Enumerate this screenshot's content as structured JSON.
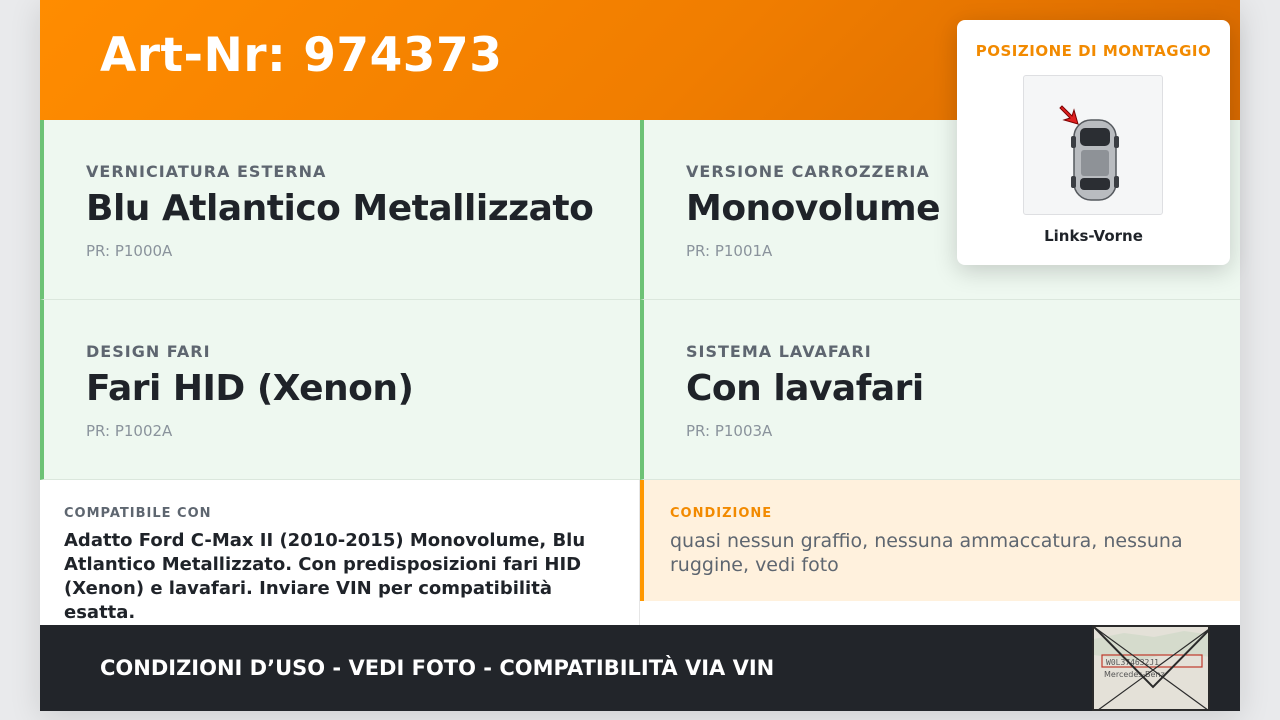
{
  "header": {
    "art_nr": "Art-Nr: 974373"
  },
  "options": [
    {
      "label": "VERNICIATURA ESTERNA",
      "value": "Blu Atlantico Metallizzato",
      "pr": "PR: P1000A"
    },
    {
      "label": "VERSIONE CARROZZERIA",
      "value": "Monovolume",
      "pr": "PR: P1001A"
    },
    {
      "label": "DESIGN FARI",
      "value": "Fari HID (Xenon)",
      "pr": "PR: P1002A"
    },
    {
      "label": "SISTEMA LAVAFARI",
      "value": "Con lavafari",
      "pr": "PR: P1003A"
    }
  ],
  "compat": {
    "label": "COMPATIBILE CON",
    "text": "Adatto Ford C-Max II (2010-2015) Monovolume, Blu Atlantico Metallizzato. Con predisposizioni fari HID (Xenon) e lavafari. Inviare VIN per compatibilità esatta."
  },
  "condition": {
    "label": "CONDIZIONE",
    "text": "quasi nessun graffio, nessuna ammaccatura, nessuna ruggine, vedi foto"
  },
  "footer": {
    "text": "CONDIZIONI D’USO - VEDI FOTO - COMPATIBILITÀ VIA VIN"
  },
  "mount": {
    "title": "POSIZIONE DI MONTAGGIO",
    "position": "Links-Vorne",
    "icon": "car-top-view-icon"
  },
  "stamp": {
    "icon": "document-label-photo",
    "label_text": "Mercedes-Benz"
  },
  "colors": {
    "accent": "#ff8c00",
    "option_bg": "#eef8f0",
    "option_border": "#6cc275",
    "condition_bg": "#fff1dd",
    "footer_bg": "#22252a"
  }
}
